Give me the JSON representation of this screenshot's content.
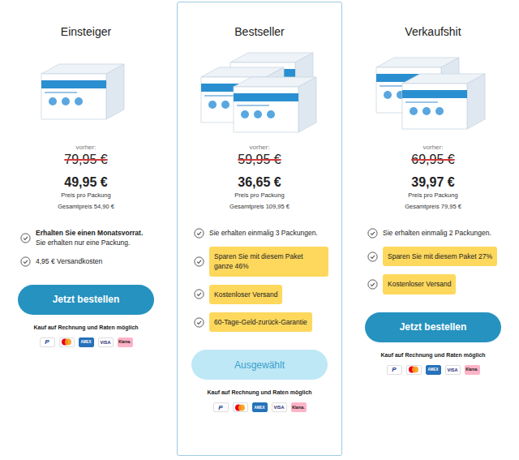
{
  "plans": [
    {
      "title": "Einsteiger",
      "selected": false,
      "box_count": 1,
      "old_price_label": "vorher:",
      "old_price": "79,95 €",
      "price": "49,95 €",
      "unit": "Preis pro Packung",
      "total": "Gesamtpreis 54,90 €",
      "features": [
        {
          "text": "Erhalten Sie einen Monatsvorrat.",
          "subtext": "Sie erhalten nur eine Packung.",
          "strong": true,
          "highlighted": false
        },
        {
          "text": "4,95 € Versandkosten",
          "subtext": "",
          "strong": false,
          "highlighted": false
        }
      ],
      "button": "Jetzt bestellen",
      "payment_note": "Kauf auf Rechnung und Raten möglich"
    },
    {
      "title": "Bestseller",
      "selected": true,
      "box_count": 3,
      "old_price_label": "vorher:",
      "old_price": "59,95 €",
      "price": "36,65 €",
      "unit": "Preis pro Packung",
      "total": "Gesamtpreis 109,95 €",
      "features": [
        {
          "text": "Sie erhalten einmalig 3 Packungen.",
          "subtext": "",
          "strong": false,
          "highlighted": false
        },
        {
          "text": "Sparen Sie mit diesem Paket ganze 46%",
          "subtext": "",
          "strong": false,
          "highlighted": true
        },
        {
          "text": "Kostenloser Versand",
          "subtext": "",
          "strong": false,
          "highlighted": true
        },
        {
          "text": "60-Tage-Geld-zurück-Garantie",
          "subtext": "",
          "strong": false,
          "highlighted": true
        }
      ],
      "button": "Ausgewählt",
      "payment_note": "Kauf auf Rechnung und Raten möglich"
    },
    {
      "title": "Verkaufshit",
      "selected": false,
      "box_count": 2,
      "old_price_label": "vorher:",
      "old_price": "69,95 €",
      "price": "39,97 €",
      "unit": "Preis pro Packung",
      "total": "Gesamtpreis 79,95 €",
      "features": [
        {
          "text": "Sie erhalten einmalig 2 Packungen.",
          "subtext": "",
          "strong": false,
          "highlighted": false
        },
        {
          "text": "Sparen Sie mit diesem Paket 27%",
          "subtext": "",
          "strong": false,
          "highlighted": true
        },
        {
          "text": "Kostenloser Versand",
          "subtext": "",
          "strong": false,
          "highlighted": true
        }
      ],
      "button": "Jetzt bestellen",
      "payment_note": "Kauf auf Rechnung und Raten möglich"
    }
  ],
  "payments": [
    {
      "kind": "paypal",
      "label": "P"
    },
    {
      "kind": "mastercard",
      "label": ""
    },
    {
      "kind": "amex",
      "label": "AMEX"
    },
    {
      "kind": "visa",
      "label": "VISA"
    },
    {
      "kind": "klarna",
      "label": "Klarna."
    }
  ]
}
